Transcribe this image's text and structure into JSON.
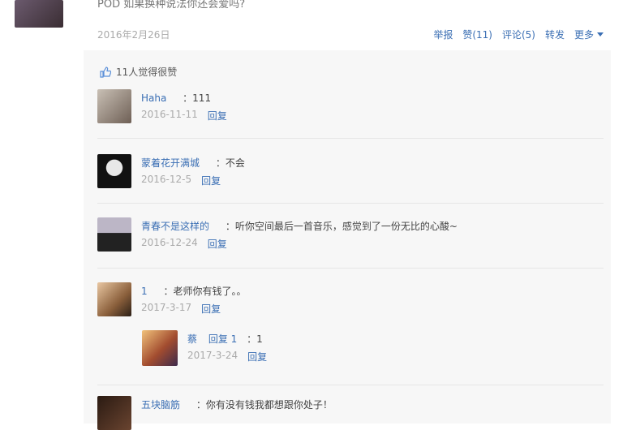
{
  "post": {
    "text": "POD 如果换种说法你还会爱吗?",
    "date": "2016年2月26日"
  },
  "actions": {
    "report": "举报",
    "like": "赞(11)",
    "comment": "评论(5)",
    "forward": "转发",
    "more": "更多"
  },
  "likes": {
    "text": "11人觉得很赞"
  },
  "comments": [
    {
      "name": "Haha",
      "text": "：111",
      "date": "2016-11-11",
      "reply": "回复"
    },
    {
      "name": "蒙着花开满城",
      "text": "：不会",
      "date": "2016-12-5",
      "reply": "回复"
    },
    {
      "name": "青春不是这样的",
      "text": "：听你空间最后一首音乐，感觉到了一份无比的心酸~",
      "date": "2016-12-24",
      "reply": "回复"
    },
    {
      "name": "1",
      "text": "：老师你有钱了。。",
      "date": "2017-3-17",
      "reply": "回复"
    },
    {
      "name": "五块脑筋",
      "text": "：你有没有钱我都想跟你处子！",
      "date": "",
      "reply": ""
    }
  ],
  "subreply": {
    "name": "蔡",
    "prefix": "回复 1",
    "text": "：1",
    "date": "2017-3-24",
    "reply": "回复"
  }
}
